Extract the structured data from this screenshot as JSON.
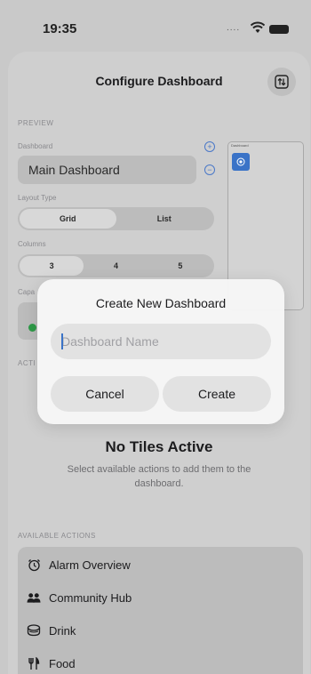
{
  "status_bar": {
    "time": "19:35",
    "signal": "...."
  },
  "sheet": {
    "title": "Configure Dashboard",
    "swap_icon": "arrow-up-down-square-icon",
    "preview_section_label": "PREVIEW",
    "dashboard_label": "Dashboard",
    "dashboard_value": "Main Dashboard",
    "layout_type_label": "Layout Type",
    "layout_options": [
      "Grid",
      "List"
    ],
    "layout_selected": "Grid",
    "columns_label": "Columns",
    "column_options": [
      "3",
      "4",
      "5"
    ],
    "columns_selected": "3",
    "capacity_label_partial": "Capa",
    "active_section_label_partial": "ACTI",
    "preview_card_title": "Dashboard",
    "empty_state": {
      "title": "No Tiles Active",
      "subtitle": "Select available actions to add them to the dashboard."
    },
    "available_actions_label": "AVAILABLE ACTIONS",
    "available_actions": [
      {
        "label": "Alarm Overview",
        "icon": "alarm-clock-icon"
      },
      {
        "label": "Community Hub",
        "icon": "people-icon"
      },
      {
        "label": "Drink",
        "icon": "drink-cup-icon"
      },
      {
        "label": "Food",
        "icon": "fork-knife-icon"
      }
    ]
  },
  "dialog": {
    "title": "Create New Dashboard",
    "input_placeholder": "Dashboard Name",
    "input_value": "",
    "cancel_label": "Cancel",
    "create_label": "Create"
  },
  "colors": {
    "accent": "#3a73c7",
    "green_indicator": "#2e9b48"
  }
}
